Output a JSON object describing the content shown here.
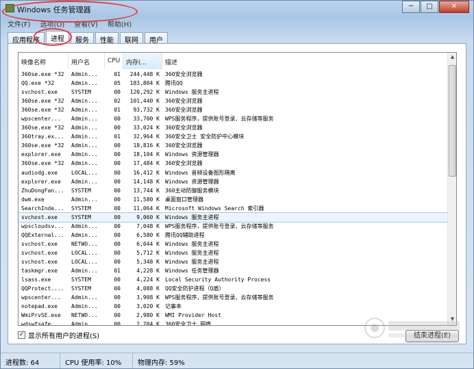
{
  "window": {
    "title": "Windows 任务管理器"
  },
  "window_buttons": {
    "minimize": "─",
    "maximize": "□",
    "close": "✕"
  },
  "menu": [
    "文件(F)",
    "选项(O)",
    "查看(V)",
    "帮助(H)"
  ],
  "tabs": [
    "应用程序",
    "进程",
    "服务",
    "性能",
    "联网",
    "用户"
  ],
  "active_tab": "进程",
  "columns": [
    "映像名称",
    "用户名",
    "CPU",
    "内存(...",
    "描述"
  ],
  "rows": [
    [
      "360se.exe *32",
      "Admin...",
      "01",
      "244,448 K",
      "360安全浏览器"
    ],
    [
      "QQ.exe *32",
      "Admin...",
      "05",
      "183,804 K",
      "腾讯QQ"
    ],
    [
      "svchost.exe",
      "SYSTEM",
      "00",
      "120,292 K",
      "Windows 服务主进程"
    ],
    [
      "360se.exe *32",
      "Admin...",
      "02",
      "101,440 K",
      "360安全浏览器"
    ],
    [
      "360se.exe *32",
      "Admin...",
      "01",
      "93,732 K",
      "360安全浏览器"
    ],
    [
      "wpscenter...",
      "Admin...",
      "00",
      "33,700 K",
      "WPS服务程序，提供账号登录、云存储等服务"
    ],
    [
      "360se.exe *32",
      "Admin...",
      "00",
      "33,024 K",
      "360安全浏览器"
    ],
    [
      "360tray.ex...",
      "Admin...",
      "01",
      "32,964 K",
      "360安全卫士 安全防护中心模块"
    ],
    [
      "360se.exe *32",
      "Admin...",
      "00",
      "18,816 K",
      "360安全浏览器"
    ],
    [
      "explorer.exe",
      "Admin...",
      "00",
      "18,104 K",
      "Windows 资源管理器"
    ],
    [
      "360se.exe *32",
      "Admin...",
      "00",
      "17,484 K",
      "360安全浏览器"
    ],
    [
      "audiodg.exe",
      "LOCAL...",
      "00",
      "16,412 K",
      "Windows 音频设备图形隔离"
    ],
    [
      "explorer.exe",
      "Admin...",
      "00",
      "14,148 K",
      "Windows 资源管理器"
    ],
    [
      "ZhuDongFan...",
      "SYSTEM",
      "00",
      "13,744 K",
      "360主动防御服务模块"
    ],
    [
      "dwm.exe",
      "Admin...",
      "00",
      "11,580 K",
      "桌面窗口管理器"
    ],
    [
      "SearchInde...",
      "SYSTEM",
      "00",
      "11,064 K",
      "Microsoft Windows Search 索引器"
    ],
    [
      "svchost.exe",
      "SYSTEM",
      "00",
      "9,060 K",
      "Windows 服务主进程"
    ],
    [
      "wpscloudsv...",
      "Admin...",
      "00",
      "7,048 K",
      "WPS服务程序，提供账号登录、云存储等服务"
    ],
    [
      "QQExternal...",
      "Admin...",
      "00",
      "6,580 K",
      "腾讯QQ辅助进程"
    ],
    [
      "svchost.exe",
      "NETWO...",
      "00",
      "6,044 K",
      "Windows 服务主进程"
    ],
    [
      "svchost.exe",
      "LOCAL...",
      "00",
      "5,712 K",
      "Windows 服务主进程"
    ],
    [
      "svchost.exe",
      "LOCAL...",
      "00",
      "5,348 K",
      "Windows 服务主进程"
    ],
    [
      "taskmgr.exe",
      "Admin...",
      "01",
      "4,228 K",
      "Windows 任务管理器"
    ],
    [
      "lsass.exe",
      "SYSTEM",
      "00",
      "4,224 K",
      "Local Security Authority Process"
    ],
    [
      "QQProtect....",
      "SYSTEM",
      "00",
      "4,088 K",
      "QQ安全防护进程（Q盾）"
    ],
    [
      "wpscenter...",
      "Admin...",
      "00",
      "3,908 K",
      "WPS服务程序，提供账号登录、云存储等服务"
    ],
    [
      "notepad.exe",
      "Admin...",
      "00",
      "3,020 K",
      "记事本"
    ],
    [
      "WmiPrvSE.exe",
      "NETWO...",
      "00",
      "2,980 K",
      "WMI Provider Host"
    ],
    [
      "wdswfsafe....",
      "Admin...",
      "00",
      "2,704 K",
      "360安全卫士 网盾"
    ]
  ],
  "selected_row": 16,
  "show_all_users": {
    "label": "显示所有用户的进程(S)",
    "checked": true
  },
  "end_process_button": "结束进程(E)",
  "status": {
    "processes": "进程数: 64",
    "cpu": "CPU 使用率: 10%",
    "memory": "物理内存: 59%"
  },
  "colors": {
    "annotation": "#e63b3b",
    "frame": "#bcd3ec"
  }
}
